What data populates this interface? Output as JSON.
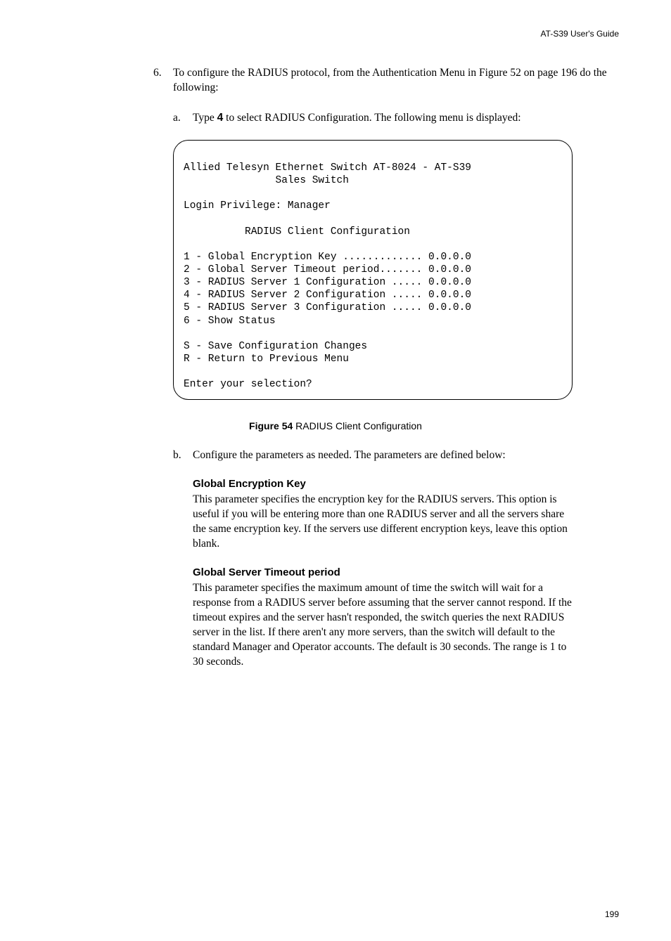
{
  "header": {
    "guide": "AT-S39 User's Guide"
  },
  "step6": {
    "number": "6.",
    "text_a": "To configure the RADIUS protocol, from the Authentication Menu in Figure 52 on page 196 do the following:"
  },
  "step_a": {
    "letter": "a.",
    "pre": "Type ",
    "bold": "4",
    "post": " to select RADIUS Configuration. The following menu is displayed:"
  },
  "terminal": {
    "line1": "Allied Telesyn Ethernet Switch AT-8024 - AT-S39",
    "line2c": "               Sales Switch",
    "blank": "",
    "login": "Login Privilege: Manager",
    "title": "          RADIUS Client Configuration",
    "m1": "1 - Global Encryption Key ............. 0.0.0.0",
    "m2": "2 - Global Server Timeout period....... 0.0.0.0",
    "m3": "3 - RADIUS Server 1 Configuration ..... 0.0.0.0",
    "m4": "4 - RADIUS Server 2 Configuration ..... 0.0.0.0",
    "m5": "5 - RADIUS Server 3 Configuration ..... 0.0.0.0",
    "m6": "6 - Show Status",
    "s": "S - Save Configuration Changes",
    "r": "R - Return to Previous Menu",
    "prompt": "Enter your selection?"
  },
  "figure": {
    "label": "Figure 54",
    "caption": "  RADIUS Client Configuration"
  },
  "step_b": {
    "letter": "b.",
    "text": "Configure the parameters as needed. The parameters are defined below:"
  },
  "param1": {
    "title": "Global Encryption Key",
    "text": "This parameter specifies the encryption key for the RADIUS servers. This option is useful if you will be entering more than one RADIUS server and all the servers share the same encryption key. If the servers use different encryption keys, leave this option blank."
  },
  "param2": {
    "title": "Global Server Timeout period",
    "text": "This parameter specifies the maximum amount of time the switch will wait for a response from a RADIUS server before assuming that the server cannot respond. If the timeout expires and the server hasn't responded, the switch queries the next RADIUS server in the list. If there aren't any more servers, than the switch will default to the standard Manager and Operator accounts. The default is 30 seconds. The range is 1 to 30 seconds."
  },
  "footer": {
    "page": "199"
  }
}
